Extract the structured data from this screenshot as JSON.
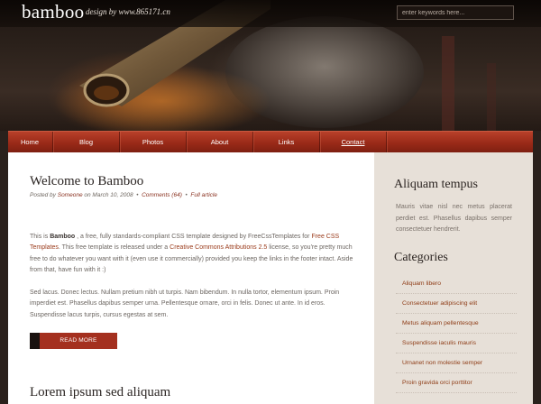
{
  "header": {
    "logo": "bamboo",
    "tagline": "design by www.865171.cn",
    "search_placeholder": "enter keywords here..."
  },
  "nav": {
    "items": [
      "Home",
      "Blog",
      "Photos",
      "About",
      "Links",
      "Contact"
    ],
    "current": "Contact"
  },
  "post1": {
    "title": "Welcome to Bamboo",
    "meta_prefix": "Posted by",
    "meta_author": "Someone",
    "meta_on": "on March 10, 2008",
    "meta_comments": "Comments (64)",
    "meta_full": "Full article",
    "p1_a": "This is",
    "p1_b": "Bamboo",
    "p1_c": ", a free, fully standards-compliant CSS template designed by FreeCssTemplates for",
    "p1_link1": "Free CSS Templates",
    "p1_d": ". This free template is released under a",
    "p1_link2": "Creative Commons Attributions 2.5",
    "p1_e": "license, so you're pretty much free to do whatever you want with it (even use it commercially) provided you keep the links in the footer intact. Aside from that, have fun with it :)",
    "p2": "Sed lacus. Donec lectus. Nullam pretium nibh ut turpis. Nam bibendum. In nulla tortor, elementum ipsum. Proin imperdiet est. Phasellus dapibus semper urna. Pellentesque ornare, orci in felis. Donec ut ante. In id eros. Suspendisse lacus turpis, cursus egestas at sem.",
    "read_more": "READ MORE"
  },
  "post2": {
    "title": "Lorem ipsum sed aliquam"
  },
  "sidebar": {
    "heading1": "Aliquam tempus",
    "text1": "Mauris vitae nisl nec metus placerat perdiet est. Phasellus dapibus semper consectetuer hendrerit.",
    "heading2": "Categories",
    "categories": [
      "Aliquam libero",
      "Consectetuer adipiscing elit",
      "Metus aliquam pellentesque",
      "Suspendisse iaculis mauris",
      "Urnanet non molestie semper",
      "Proin gravida orci porttitor"
    ]
  },
  "colors": {
    "nav_red": "#9a2a18",
    "link": "#8e3c16",
    "sidebar_bg": "#e7e0d8",
    "header_dark": "#1e1612"
  }
}
